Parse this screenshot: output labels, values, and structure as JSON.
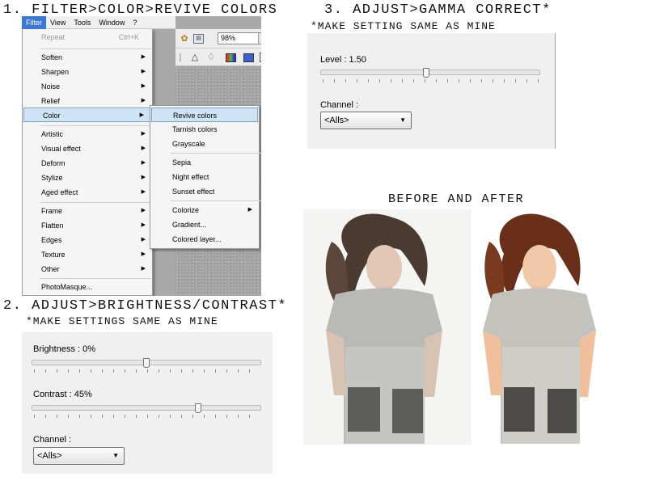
{
  "steps": {
    "step1_title": "1. FILTER>COLOR>REVIVE COLORS",
    "step2_title": "2. ADJUST>BRIGHTNESS/CONTRAST*",
    "step2_note": "*MAKE SETTINGS SAME AS MINE",
    "step3_title": "3. ADJUST>GAMMA CORRECT*",
    "step3_note": "*MAKE SETTING SAME AS MINE",
    "before_after_title": "BEFORE AND AFTER"
  },
  "menubar": {
    "items": [
      "Filter",
      "View",
      "Tools",
      "Window",
      "?"
    ],
    "active_index": 0
  },
  "toolbar": {
    "zoom_value": "98%",
    "icons": [
      "palette-icon",
      "window-icon",
      "zoom-icon",
      "triangle-icon",
      "drop-icon",
      "rgb-icon",
      "screen-icon",
      "crop-icon"
    ]
  },
  "filter_menu": {
    "repeat_label": "Repeat",
    "repeat_shortcut": "Ctrl+K",
    "items": [
      "Soften",
      "Sharpen",
      "Noise",
      "Relief",
      "Color",
      "Artistic",
      "Visual effect",
      "Deform",
      "Stylize",
      "Aged effect",
      "Frame",
      "Flatten",
      "Edges",
      "Texture",
      "Other",
      "PhotoMasque..."
    ],
    "highlighted": "Color"
  },
  "color_submenu": {
    "items": [
      "Revive colors",
      "Tarnish colors",
      "Grayscale",
      "Sepia",
      "Night effect",
      "Sunset effect",
      "Colorize",
      "Gradient...",
      "Colored layer..."
    ],
    "highlighted": "Revive colors"
  },
  "brightness_contrast": {
    "brightness_label": "Brightness : 0%",
    "brightness_value": 0,
    "contrast_label": "Contrast : 45%",
    "contrast_value": 45,
    "channel_label": "Channel :",
    "channel_value": "<Alls>"
  },
  "gamma": {
    "level_label": "Level : 1.50",
    "level_value": 1.5,
    "channel_label": "Channel :",
    "channel_value": "<Alls>"
  },
  "colors": {
    "menu_highlight": "#cfe3f7",
    "menubar_active": "#3c78d8",
    "panel_bg": "#f0f0f0"
  }
}
